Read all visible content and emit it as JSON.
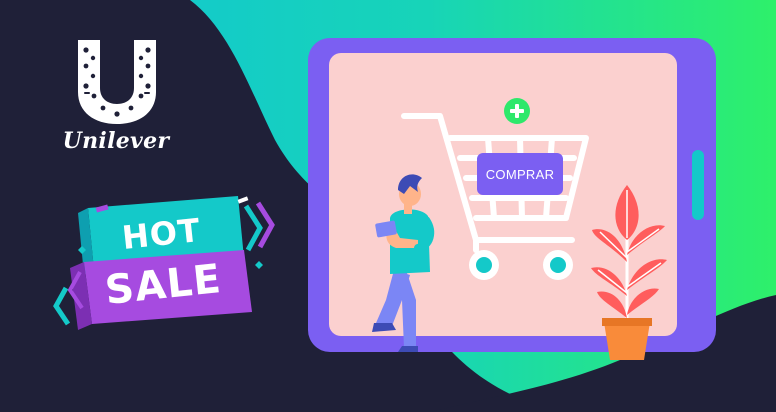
{
  "brand": {
    "name": "Unilever",
    "logo_icon": "unilever-u-emblem-icon"
  },
  "promo": {
    "line1": "HOT",
    "line2": "SALE"
  },
  "tablet": {
    "buy_button_label": "COMPRAR",
    "cart_icon": "shopping-cart-icon",
    "add_icon": "plus-circle-icon"
  },
  "colors": {
    "navy": "#1f2038",
    "teal": "#14c9c9",
    "green": "#2ee86b",
    "purple": "#7b5ff2",
    "pink_screen": "#fbd0cf",
    "red_leaf": "#ff5d5d",
    "orange_pot": "#f98b3a",
    "magenta": "#a64be0"
  }
}
